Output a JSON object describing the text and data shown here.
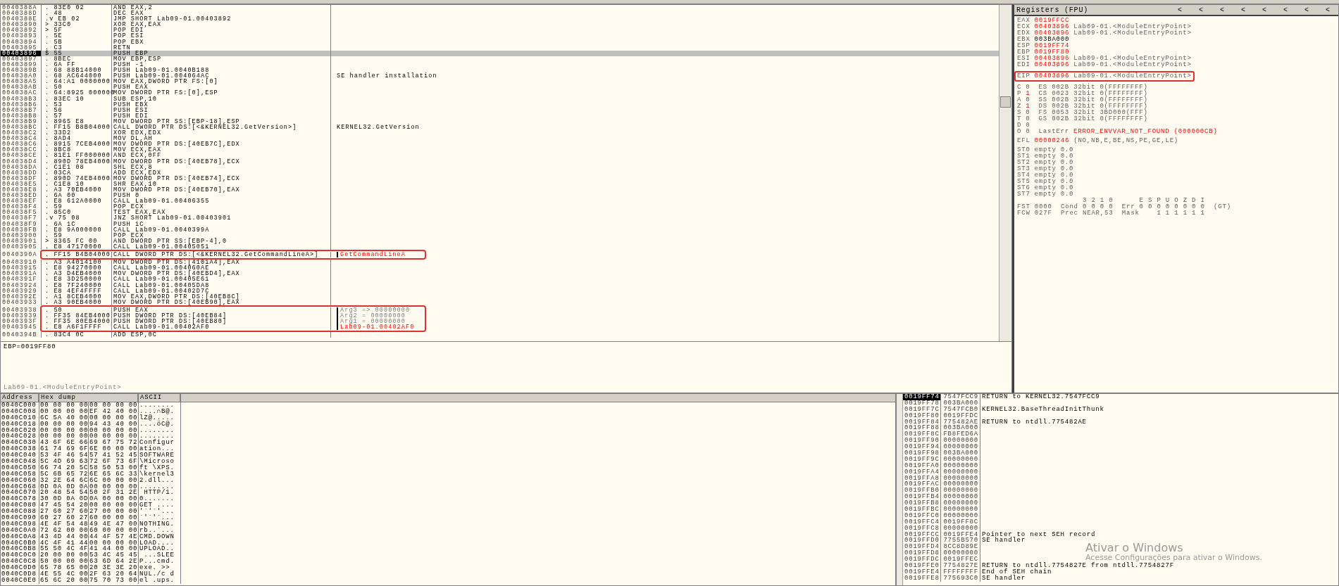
{
  "disassembly": {
    "rows": [
      {
        "address": "0040388A",
        "marker": ".",
        "hex": "83E0 02",
        "instruction": "AND EAX,2",
        "selected": false,
        "boxed": false
      },
      {
        "address": "0040388D",
        "marker": ".",
        "hex": "48",
        "instruction": "DEC EAX",
        "selected": false,
        "boxed": false
      },
      {
        "address": "0040388E",
        "marker": ".v",
        "hex": "EB 02",
        "instruction": "JMP SHORT Lab09-01.00403892",
        "selected": false,
        "boxed": false
      },
      {
        "address": "00403890",
        "marker": ">",
        "hex": "33C0",
        "instruction": "XOR EAX,EAX",
        "selected": false,
        "boxed": false
      },
      {
        "address": "00403892",
        "marker": ">",
        "hex": "5F",
        "instruction": "POP EDI",
        "selected": false,
        "boxed": false
      },
      {
        "address": "00403893",
        "marker": ".",
        "hex": "5E",
        "instruction": "POP ESI",
        "selected": false,
        "boxed": false
      },
      {
        "address": "00403894",
        "marker": ".",
        "hex": "5B",
        "instruction": "POP EBX",
        "selected": false,
        "boxed": false
      },
      {
        "address": "00403895",
        "marker": ".",
        "hex": "C3",
        "instruction": "RETN",
        "selected": false,
        "boxed": false
      },
      {
        "address": "00403896",
        "marker": "$",
        "hex": "55",
        "instruction": "PUSH EBP",
        "selected": true,
        "boxed": false
      },
      {
        "address": "00403897",
        "marker": ".",
        "hex": "8BEC",
        "instruction": "MOV EBP,ESP",
        "selected": false,
        "boxed": false
      },
      {
        "address": "00403899",
        "marker": ".",
        "hex": "6A FF",
        "instruction": "PUSH -1",
        "selected": false,
        "boxed": false
      },
      {
        "address": "0040389B",
        "marker": ".",
        "hex": "68 88B14000",
        "instruction": "PUSH Lab09-01.0040B188",
        "selected": false,
        "boxed": false
      },
      {
        "address": "004038A0",
        "marker": ".",
        "hex": "68 AC644000",
        "instruction": "PUSH Lab09-01.004064AC",
        "comment": "SE handler installation",
        "kind": "plain",
        "selected": false,
        "boxed": false
      },
      {
        "address": "004038A5",
        "marker": ".",
        "hex": "64:A1 0000000",
        "instruction": "MOV EAX,DWORD PTR FS:[0]",
        "selected": false,
        "boxed": false
      },
      {
        "address": "004038AB",
        "marker": ".",
        "hex": "50",
        "instruction": "PUSH EAX",
        "selected": false,
        "boxed": false
      },
      {
        "address": "004038AC",
        "marker": ".",
        "hex": "64:8925 000000",
        "instruction": "MOV DWORD PTR FS:[0],ESP",
        "selected": false,
        "boxed": false
      },
      {
        "address": "004038B3",
        "marker": ".",
        "hex": "83EC 10",
        "instruction": "SUB ESP,10",
        "selected": false,
        "boxed": false
      },
      {
        "address": "004038B6",
        "marker": ".",
        "hex": "53",
        "instruction": "PUSH EBX",
        "selected": false,
        "boxed": false
      },
      {
        "address": "004038B7",
        "marker": ".",
        "hex": "56",
        "instruction": "PUSH ESI",
        "selected": false,
        "boxed": false
      },
      {
        "address": "004038B8",
        "marker": ".",
        "hex": "57",
        "instruction": "PUSH EDI",
        "selected": false,
        "boxed": false
      },
      {
        "address": "004038B9",
        "marker": ".",
        "hex": "8965 E8",
        "instruction": "MOV DWORD PTR SS:[EBP-18],ESP",
        "selected": false,
        "boxed": false
      },
      {
        "address": "004038BC",
        "marker": ".",
        "hex": "FF15 B8B04000",
        "instruction": "CALL DWORD PTR DS:[<&KERNEL32.GetVersion>]",
        "comment": "KERNEL32.GetVersion",
        "kind": "plain",
        "selected": false,
        "boxed": false
      },
      {
        "address": "004038C2",
        "marker": ".",
        "hex": "33D2",
        "instruction": "XOR EDX,EDX",
        "selected": false,
        "boxed": false
      },
      {
        "address": "004038C4",
        "marker": ".",
        "hex": "8AD4",
        "instruction": "MOV DL,AH",
        "selected": false,
        "boxed": false
      },
      {
        "address": "004038C6",
        "marker": ".",
        "hex": "8915 7CEB4000",
        "instruction": "MOV DWORD PTR DS:[40EB7C],EDX",
        "selected": false,
        "boxed": false
      },
      {
        "address": "004038CC",
        "marker": ".",
        "hex": "8BC8",
        "instruction": "MOV ECX,EAX",
        "selected": false,
        "boxed": false
      },
      {
        "address": "004038CE",
        "marker": ".",
        "hex": "81E1 FF000000",
        "instruction": "AND ECX,0FF",
        "selected": false,
        "boxed": false
      },
      {
        "address": "004038D4",
        "marker": ".",
        "hex": "890D 78EB4000",
        "instruction": "MOV DWORD PTR DS:[40EB78],ECX",
        "selected": false,
        "boxed": false
      },
      {
        "address": "004038DA",
        "marker": ".",
        "hex": "C1E1 08",
        "instruction": "SHL ECX,8",
        "selected": false,
        "boxed": false
      },
      {
        "address": "004038DD",
        "marker": ".",
        "hex": "03CA",
        "instruction": "ADD ECX,EDX",
        "selected": false,
        "boxed": false
      },
      {
        "address": "004038DF",
        "marker": ".",
        "hex": "890D 74EB4000",
        "instruction": "MOV DWORD PTR DS:[40EB74],ECX",
        "selected": false,
        "boxed": false
      },
      {
        "address": "004038E5",
        "marker": ".",
        "hex": "C1E8 10",
        "instruction": "SHR EAX,10",
        "selected": false,
        "boxed": false
      },
      {
        "address": "004038E8",
        "marker": ".",
        "hex": "A3 70EB4000",
        "instruction": "MOV DWORD PTR DS:[40EB70],EAX",
        "selected": false,
        "boxed": false
      },
      {
        "address": "004038ED",
        "marker": ".",
        "hex": "6A 00",
        "instruction": "PUSH 0",
        "selected": false,
        "boxed": false
      },
      {
        "address": "004038EF",
        "marker": ".",
        "hex": "E8 612A0000",
        "instruction": "CALL Lab09-01.00406355",
        "selected": false,
        "boxed": false
      },
      {
        "address": "004038F4",
        "marker": ".",
        "hex": "59",
        "instruction": "POP ECX",
        "selected": false,
        "boxed": false
      },
      {
        "address": "004038F5",
        "marker": ".",
        "hex": "85C0",
        "instruction": "TEST EAX,EAX",
        "selected": false,
        "boxed": false
      },
      {
        "address": "004038F7",
        "marker": ".v",
        "hex": "75 08",
        "instruction": "JNZ SHORT Lab09-01.00403901",
        "selected": false,
        "boxed": false
      },
      {
        "address": "004038F9",
        "marker": ".",
        "hex": "6A 1C",
        "instruction": "PUSH 1C",
        "selected": false,
        "boxed": false
      },
      {
        "address": "004038FB",
        "marker": ".",
        "hex": "E8 9A000000",
        "instruction": "CALL Lab09-01.0040399A",
        "selected": false,
        "boxed": false
      },
      {
        "address": "00403900",
        "marker": ".",
        "hex": "59",
        "instruction": "POP ECX",
        "selected": false,
        "boxed": false
      },
      {
        "address": "00403901",
        "marker": ">",
        "hex": "8365 FC 00",
        "instruction": "AND DWORD PTR SS:[EBP-4],0",
        "selected": false,
        "boxed": false
      },
      {
        "address": "00403905",
        "marker": ".",
        "hex": "E8 47170000",
        "instruction": "CALL Lab09-01.00405051",
        "selected": false,
        "boxed": false
      },
      {
        "address": "0040390A",
        "marker": ".",
        "hex": "FF15 B4B04000",
        "instruction": "CALL DWORD PTR DS:[<&KERNEL32.GetCommandLineA>]",
        "comment": "GetCommandLineA",
        "kind": "api",
        "selected": false,
        "boxed": true
      },
      {
        "address": "00403910",
        "marker": ".",
        "hex": "A3 A4014100",
        "instruction": "MOV DWORD PTR DS:[4101A4],EAX",
        "selected": false,
        "boxed": false
      },
      {
        "address": "00403915",
        "marker": ".",
        "hex": "E8 94270000",
        "instruction": "CALL Lab09-01.004060AE",
        "selected": false,
        "boxed": false
      },
      {
        "address": "0040391A",
        "marker": ".",
        "hex": "A3 D4EB4000",
        "instruction": "MOV DWORD PTR DS:[40EBD4],EAX",
        "selected": false,
        "boxed": false
      },
      {
        "address": "0040391F",
        "marker": ".",
        "hex": "E8 3D250000",
        "instruction": "CALL Lab09-01.00405E61",
        "selected": false,
        "boxed": false
      },
      {
        "address": "00403924",
        "marker": ".",
        "hex": "E8 7F240000",
        "instruction": "CALL Lab09-01.00405DA8",
        "selected": false,
        "boxed": false
      },
      {
        "address": "00403929",
        "marker": ".",
        "hex": "E8 4EF4FFFF",
        "instruction": "CALL Lab09-01.00402D7C",
        "selected": false,
        "boxed": false
      },
      {
        "address": "0040392E",
        "marker": ".",
        "hex": "A1 8CEB4000",
        "instruction": "MOV EAX,DWORD PTR DS:[40EB8C]",
        "selected": false,
        "boxed": false
      },
      {
        "address": "00403933",
        "marker": ".",
        "hex": "A3 90EB4000",
        "instruction": "MOV DWORD PTR DS:[40EB90],EAX",
        "selected": false,
        "boxed": false
      },
      {
        "address": "00403938",
        "marker": ".",
        "hex": "50",
        "instruction": "PUSH EAX",
        "comment": "Arg3 => 00000000",
        "kind": "arg",
        "selected": false,
        "boxed": true
      },
      {
        "address": "00403939",
        "marker": ".",
        "hex": "FF35 84EB4000",
        "instruction": "PUSH DWORD PTR DS:[40EB84]",
        "comment": "Arg2 = 00000000",
        "kind": "arg",
        "selected": false,
        "boxed": true
      },
      {
        "address": "0040393F",
        "marker": ".",
        "hex": "FF35 80EB4000",
        "instruction": "PUSH DWORD PTR DS:[40EB80]",
        "comment": "Arg1 = 00000000",
        "kind": "arg",
        "selected": false,
        "boxed": true
      },
      {
        "address": "00403945",
        "marker": ".",
        "hex": "E8 A6F1FFFF",
        "instruction": "CALL Lab09-01.00402AF0",
        "comment": "Lab09-01.00402AF0",
        "kind": "target",
        "selected": false,
        "boxed": true
      },
      {
        "address": "0040394B",
        "marker": ".",
        "hex": "83C4 0C",
        "instruction": "ADD ESP,0C",
        "selected": false,
        "boxed": false
      }
    ]
  },
  "info": {
    "value_line": "EBP=0019FF80",
    "location": "Lab09-01.<ModuleEntryPoint>"
  },
  "registers": {
    "title": "Registers (FPU)",
    "buttons": [
      "<",
      "<",
      "<",
      "<",
      "<",
      "<",
      "<",
      "<"
    ],
    "general": [
      {
        "name": "EAX",
        "value": "0019FFCC",
        "changed": true
      },
      {
        "name": "ECX",
        "value": "00403896",
        "changed": true,
        "note": "Lab09-01.<ModuleEntryPoint>"
      },
      {
        "name": "EDX",
        "value": "00403896",
        "changed": true,
        "note": "Lab09-01.<ModuleEntryPoint>"
      },
      {
        "name": "EBX",
        "value": "003BA000",
        "changed": false
      },
      {
        "name": "ESP",
        "value": "0019FF74",
        "changed": true
      },
      {
        "name": "EBP",
        "value": "0019FF80",
        "changed": true
      },
      {
        "name": "ESI",
        "value": "00403896",
        "changed": true,
        "note": "Lab09-01.<ModuleEntryPoint>"
      },
      {
        "name": "EDI",
        "value": "00403896",
        "changed": true,
        "note": "Lab09-01.<ModuleEntryPoint>"
      }
    ],
    "eip": {
      "name": "EIP",
      "value": "00403896",
      "changed": true,
      "note": "Lab09-01.<ModuleEntryPoint>",
      "boxed": true
    },
    "flags": [
      {
        "flag": "C",
        "value": "0",
        "changed": false,
        "segment": "ES 002B 32bit 0(FFFFFFFF)"
      },
      {
        "flag": "P",
        "value": "1",
        "changed": true,
        "segment": "CS 0023 32bit 0(FFFFFFFF)"
      },
      {
        "flag": "A",
        "value": "0",
        "changed": false,
        "segment": "SS 002B 32bit 0(FFFFFFFF)"
      },
      {
        "flag": "Z",
        "value": "1",
        "changed": true,
        "segment": "DS 002B 32bit 0(FFFFFFFF)"
      },
      {
        "flag": "S",
        "value": "0",
        "changed": false,
        "segment": "FS 0053 32bit 3BD000(FFF)"
      },
      {
        "flag": "T",
        "value": "0",
        "changed": false,
        "segment": "GS 002B 32bit 0(FFFFFFFF)"
      },
      {
        "flag": "D",
        "value": "0",
        "changed": false
      },
      {
        "flag": "O",
        "value": "0",
        "changed": false
      }
    ],
    "last_error": {
      "label": "LastErr",
      "value": "ERROR_ENVVAR_NOT_FOUND (000000CB)"
    },
    "efl": {
      "name": "EFL",
      "value": "00000246",
      "changed": true,
      "note": "(NO,NB,E,BE,NS,PE,GE,LE)"
    },
    "fpu": [
      {
        "name": "ST0",
        "tag": "empty",
        "value": "0.0"
      },
      {
        "name": "ST1",
        "tag": "empty",
        "value": "0.0"
      },
      {
        "name": "ST2",
        "tag": "empty",
        "value": "0.0"
      },
      {
        "name": "ST3",
        "tag": "empty",
        "value": "0.0"
      },
      {
        "name": "ST4",
        "tag": "empty",
        "value": "0.0"
      },
      {
        "name": "ST5",
        "tag": "empty",
        "value": "0.0"
      },
      {
        "name": "ST6",
        "tag": "empty",
        "value": "0.0"
      },
      {
        "name": "ST7",
        "tag": "empty",
        "value": "0.0"
      }
    ],
    "fpu_status": [
      "               3 2 1 0      E S P U O Z D I",
      "FST 0000  Cond 0 0 0 0  Err 0 0 0 0 0 0 0 0  (GT)",
      "FCW 027F  Prec NEAR,53  Mask    1 1 1 1 1 1"
    ]
  },
  "dump": {
    "columns": [
      "Address",
      "Hex dump",
      "ASCII"
    ],
    "rows": [
      {
        "address": "0040C000",
        "bytes": [
          "00 00 00 00",
          "00 00 00 00"
        ],
        "ascii": "........"
      },
      {
        "address": "0040C008",
        "bytes": [
          "00 00 00 00",
          "EF 42 40 00"
        ],
        "ascii": "....∩B@."
      },
      {
        "address": "0040C010",
        "bytes": [
          "6C 5A 40 00",
          "00 00 00 00"
        ],
        "ascii": "lZ@....."
      },
      {
        "address": "0040C018",
        "bytes": [
          "00 00 00 00",
          "94 43 40 00"
        ],
        "ascii": "....öC@."
      },
      {
        "address": "0040C020",
        "bytes": [
          "00 00 00 00",
          "00 00 00 00"
        ],
        "ascii": "........"
      },
      {
        "address": "0040C028",
        "bytes": [
          "00 00 00 00",
          "00 00 00 00"
        ],
        "ascii": "........"
      },
      {
        "address": "0040C030",
        "bytes": [
          "43 6F 6E 66",
          "69 67 75 72"
        ],
        "ascii": "Configur"
      },
      {
        "address": "0040C038",
        "bytes": [
          "61 74 69 6F",
          "6E 00 00 00"
        ],
        "ascii": "ation..."
      },
      {
        "address": "0040C040",
        "bytes": [
          "53 4F 46 54",
          "57 41 52 45"
        ],
        "ascii": "SOFTWARE"
      },
      {
        "address": "0040C048",
        "bytes": [
          "5C 4D 69 63",
          "72 6F 73 6F"
        ],
        "ascii": "\\Microso"
      },
      {
        "address": "0040C050",
        "bytes": [
          "66 74 20 5C",
          "58 50 53 00"
        ],
        "ascii": "ft \\XPS."
      },
      {
        "address": "0040C058",
        "bytes": [
          "5C 6B 65 72",
          "6E 65 6C 33"
        ],
        "ascii": "\\kernel3"
      },
      {
        "address": "0040C060",
        "bytes": [
          "32 2E 64 6C",
          "6C 00 00 00"
        ],
        "ascii": "2.dll..."
      },
      {
        "address": "0040C068",
        "bytes": [
          "0D 0A 0D 0A",
          "00 00 00 00"
        ],
        "ascii": "........"
      },
      {
        "address": "0040C070",
        "bytes": [
          "20 48 54 54",
          "50 2F 31 2E"
        ],
        "ascii": " HTTP/1."
      },
      {
        "address": "0040C078",
        "bytes": [
          "30 0D 0A 0D",
          "0A 00 00 00"
        ],
        "ascii": "0......."
      },
      {
        "address": "0040C080",
        "bytes": [
          "47 45 54 20",
          "00 00 00 00"
        ],
        "ascii": "GET ...."
      },
      {
        "address": "0040C088",
        "bytes": [
          "27 60 27 60",
          "27 00 00 00"
        ],
        "ascii": "'`'`'..."
      },
      {
        "address": "0040C090",
        "bytes": [
          "60 27 60 27",
          "60 00 00 00"
        ],
        "ascii": "`'`'`..."
      },
      {
        "address": "0040C098",
        "bytes": [
          "4E 4F 54 48",
          "49 4E 47 00"
        ],
        "ascii": "NOTHING."
      },
      {
        "address": "0040C0A0",
        "bytes": [
          "72 62 00 00",
          "60 00 00 00"
        ],
        "ascii": "rb..`..."
      },
      {
        "address": "0040C0A8",
        "bytes": [
          "43 4D 44 00",
          "44 4F 57 4E"
        ],
        "ascii": "CMD.DOWN"
      },
      {
        "address": "0040C0B0",
        "bytes": [
          "4C 4F 41 44",
          "00 00 00 00"
        ],
        "ascii": "LOAD...."
      },
      {
        "address": "0040C0B8",
        "bytes": [
          "55 50 4C 4F",
          "41 44 00 00"
        ],
        "ascii": "UPLOAD.."
      },
      {
        "address": "0040C0C0",
        "bytes": [
          "20 00 00 00",
          "53 4C 45 45"
        ],
        "ascii": " ...SLEE"
      },
      {
        "address": "0040C0C8",
        "bytes": [
          "50 00 00 00",
          "63 6D 64 2E"
        ],
        "ascii": "P...cmd."
      },
      {
        "address": "0040C0D0",
        "bytes": [
          "65 78 65 00",
          "20 3E 3E 20"
        ],
        "ascii": "exe. >> "
      },
      {
        "address": "0040C0D8",
        "bytes": [
          "4E 55 4C 00",
          "2F 63 20 64"
        ],
        "ascii": "NUL./c d"
      },
      {
        "address": "0040C0E0",
        "bytes": [
          "65 6C 20 00",
          "75 70 73 00"
        ],
        "ascii": "el .ups."
      }
    ]
  },
  "stack": {
    "rows": [
      {
        "address": "0019FF74",
        "value": "7547FCC9",
        "comment": "RETURN to KERNEL32.7547FCC9",
        "selected": true
      },
      {
        "address": "0019FF78",
        "value": "003BA000",
        "selected": false
      },
      {
        "address": "0019FF7C",
        "value": "7547FCB0",
        "comment": "KERNEL32.BaseThreadInitThunk",
        "selected": false
      },
      {
        "address": "0019FF80",
        "value": "0019FFDC",
        "selected": false
      },
      {
        "address": "0019FF84",
        "value": "775482AE",
        "comment": "RETURN to ntdll.775482AE",
        "selected": false
      },
      {
        "address": "0019FF88",
        "value": "003BA000",
        "selected": false
      },
      {
        "address": "0019FF8C",
        "value": "FB8FED6A",
        "selected": false
      },
      {
        "address": "0019FF90",
        "value": "00000000",
        "selected": false
      },
      {
        "address": "0019FF94",
        "value": "00000000",
        "selected": false
      },
      {
        "address": "0019FF98",
        "value": "003BA000",
        "selected": false
      },
      {
        "address": "0019FF9C",
        "value": "00000000",
        "selected": false
      },
      {
        "address": "0019FFA0",
        "value": "00000000",
        "selected": false
      },
      {
        "address": "0019FFA4",
        "value": "00000000",
        "selected": false
      },
      {
        "address": "0019FFA8",
        "value": "00000000",
        "selected": false
      },
      {
        "address": "0019FFAC",
        "value": "00000000",
        "selected": false
      },
      {
        "address": "0019FFB0",
        "value": "00000000",
        "selected": false
      },
      {
        "address": "0019FFB4",
        "value": "00000000",
        "selected": false
      },
      {
        "address": "0019FFB8",
        "value": "00000000",
        "selected": false
      },
      {
        "address": "0019FFBC",
        "value": "00000000",
        "selected": false
      },
      {
        "address": "0019FFC0",
        "value": "00000000",
        "selected": false
      },
      {
        "address": "0019FFC4",
        "value": "0019FF8C",
        "selected": false
      },
      {
        "address": "0019FFC8",
        "value": "00000000",
        "selected": false
      },
      {
        "address": "0019FFCC",
        "value": "0019FFE4",
        "comment": "Pointer to next SEH record",
        "selected": false
      },
      {
        "address": "0019FFD0",
        "value": "7755B570",
        "comment": "SE handler",
        "selected": false
      },
      {
        "address": "0019FFD4",
        "value": "8CC8D89E",
        "selected": false
      },
      {
        "address": "0019FFD8",
        "value": "00000000",
        "selected": false
      },
      {
        "address": "0019FFDC",
        "value": "0019FFEC",
        "selected": false
      },
      {
        "address": "0019FFE0",
        "value": "7754827E",
        "comment": "RETURN to ntdll.7754827E from ntdll.7754827F",
        "selected": false
      },
      {
        "address": "0019FFE4",
        "value": "FFFFFFFF",
        "comment": "End of SEH chain",
        "selected": false
      },
      {
        "address": "0019FFE8",
        "value": "775693C0",
        "comment": "SE handler",
        "selected": false
      }
    ]
  },
  "activation_notice": {
    "title": "Ativar o Windows",
    "subtitle": "Acesse Configurações para ativar o Windows."
  }
}
